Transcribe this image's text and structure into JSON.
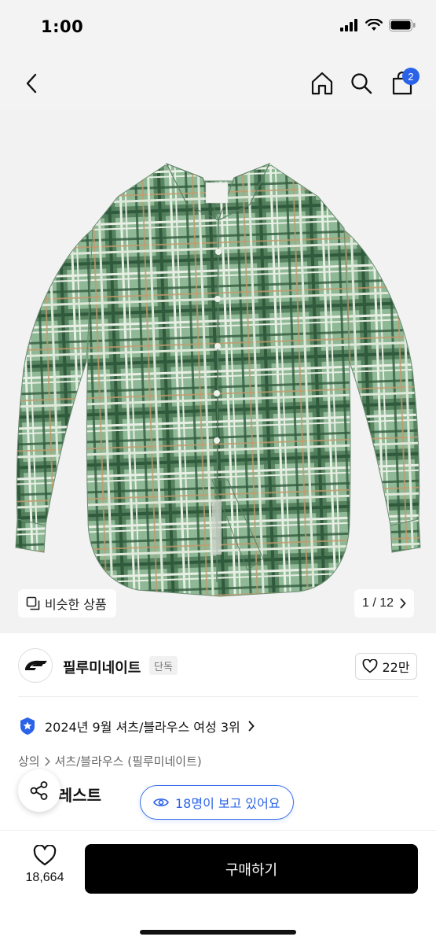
{
  "status": {
    "time": "1:00"
  },
  "header": {
    "cart_count": "2"
  },
  "hero": {
    "similar_label": "비슷한 상품",
    "pager": "1 / 12"
  },
  "brand": {
    "name": "필루미네이트",
    "tag": "단독",
    "likes": "22만"
  },
  "ranking": {
    "text": "2024년 9월 셔츠/블라우스 여성 3위"
  },
  "breadcrumb": {
    "items": [
      "상의",
      "셔츠/블라우스 (필루미네이트)"
    ]
  },
  "product": {
    "title_visible": "핏 포레스트"
  },
  "viewers": {
    "text": "18명이 보고 있어요"
  },
  "bottom": {
    "wish_count": "18,664",
    "buy_label": "구매하기"
  },
  "colors": {
    "accent": "#2a63e8",
    "shirt_green": "#8fb896",
    "plaid_dark": "#2f5a3c"
  }
}
